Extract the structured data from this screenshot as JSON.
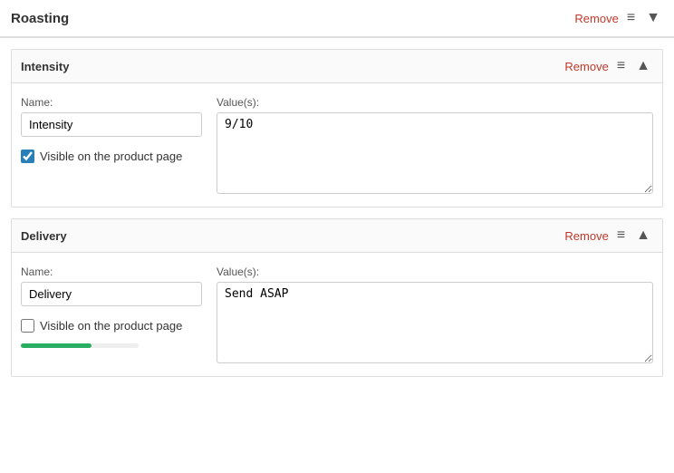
{
  "top": {
    "title": "Roasting",
    "remove_label": "Remove",
    "menu_icon": "≡",
    "chevron_icon": "▼"
  },
  "sections": [
    {
      "id": "intensity",
      "title": "Intensity",
      "remove_label": "Remove",
      "menu_icon": "≡",
      "chevron_icon": "▲",
      "name_label": "Name:",
      "name_value": "Intensity",
      "values_label": "Value(s):",
      "values_value": "9/10",
      "checkbox_label": "Visible on the product page",
      "checkbox_checked": true,
      "show_progress": false,
      "progress_pct": 0
    },
    {
      "id": "delivery",
      "title": "Delivery",
      "remove_label": "Remove",
      "menu_icon": "≡",
      "chevron_icon": "▲",
      "name_label": "Name:",
      "name_value": "Delivery",
      "values_label": "Value(s):",
      "values_value": "Send ASAP",
      "checkbox_label": "Visible on the product page",
      "checkbox_checked": false,
      "show_progress": true,
      "progress_pct": 60
    }
  ]
}
